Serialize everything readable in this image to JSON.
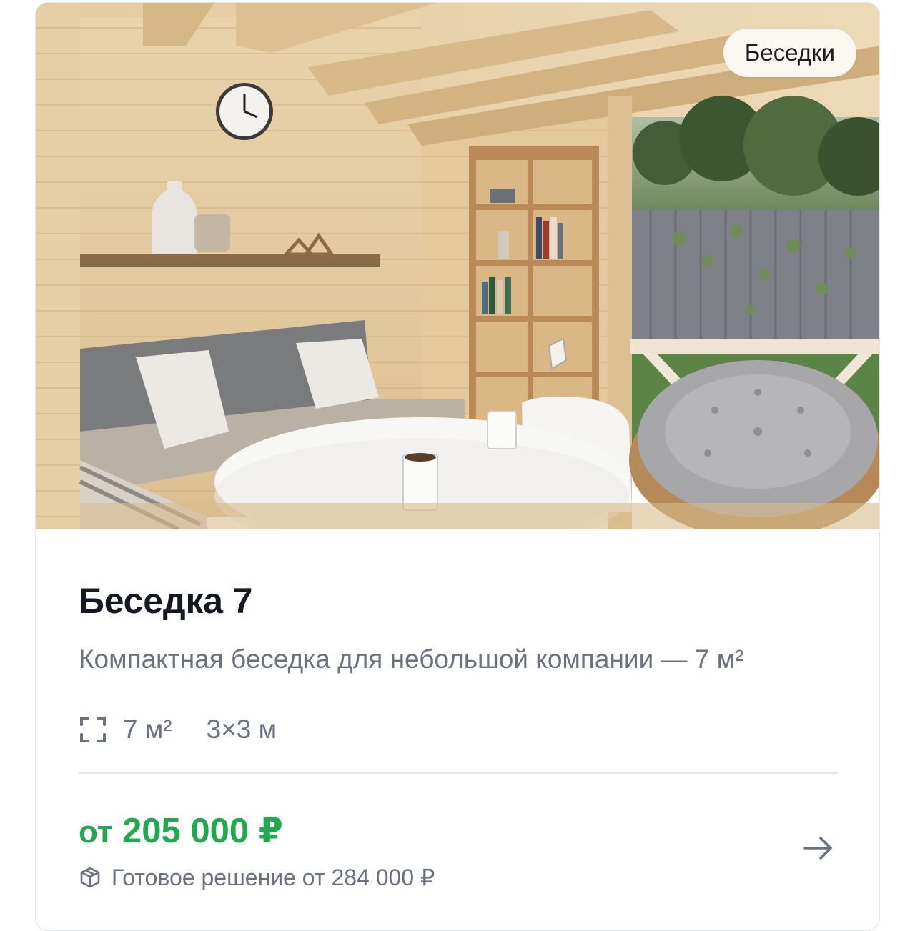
{
  "card": {
    "badge": "Беседки",
    "title": "Беседка 7",
    "description": "Компактная беседка для небольшой компании — 7 м²",
    "specs": {
      "area_icon": "area-frame-icon",
      "area": "7 м²",
      "dimensions": "3×3 м"
    },
    "price": {
      "prefix": "от",
      "amount": "205 000 ₽"
    },
    "ready_solution": {
      "icon": "box-icon",
      "text": "Готовое решение от 284 000 ₽"
    },
    "arrow_icon": "arrow-right-icon"
  },
  "colors": {
    "price_green": "#22a94f",
    "title": "#141820",
    "muted_text": "#6a7281",
    "badge_bg": "#fbf7f1"
  }
}
